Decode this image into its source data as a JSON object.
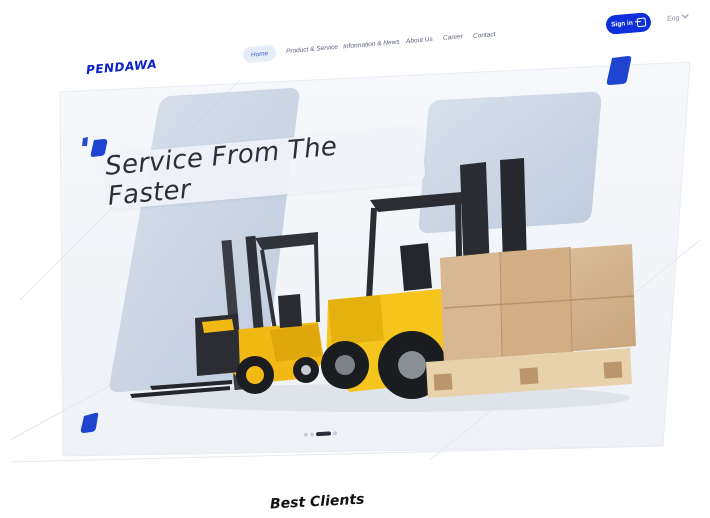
{
  "brand": {
    "logo_text": "PENDAWA",
    "accent": "#0e2fd9"
  },
  "nav": {
    "items": [
      {
        "label": "Home",
        "active": true
      },
      {
        "label": "Product & Service"
      },
      {
        "label": "Information & News"
      },
      {
        "label": "About Us"
      },
      {
        "label": "Career"
      },
      {
        "label": "Contact"
      }
    ],
    "signin_label": "Sign in",
    "signin_icon": "login-arrow-icon",
    "language": "Eng",
    "language_icon": "chevron-down-icon"
  },
  "hero": {
    "title": "Service From The Faster",
    "image": "forklifts-with-pallet",
    "slides": {
      "count": 4,
      "active": 3
    }
  },
  "section": {
    "heading": "Best Clients"
  }
}
